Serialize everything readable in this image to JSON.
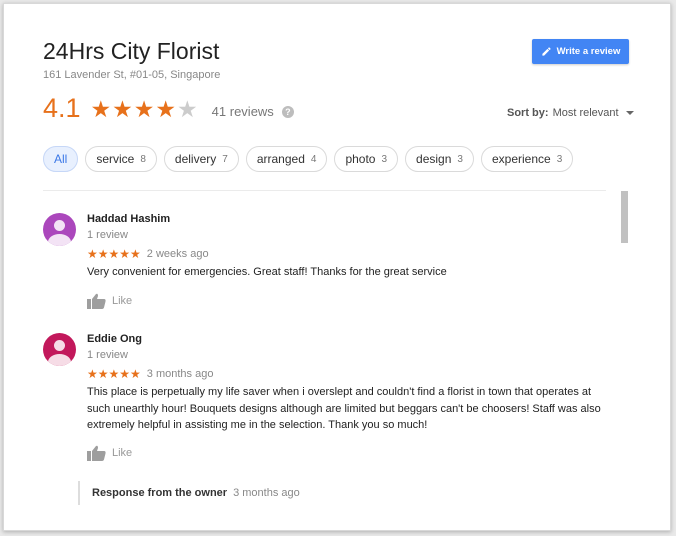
{
  "business": {
    "name": "24Hrs City Florist",
    "address": "161 Lavender St, #01-05, Singapore"
  },
  "write_review_label": "Write a review",
  "rating": {
    "value": "4.1",
    "stars_filled": 4,
    "reviews_label": "41 reviews",
    "help_glyph": "?"
  },
  "sort": {
    "label": "Sort by:",
    "value": "Most relevant"
  },
  "chips": [
    {
      "label": "All",
      "count": ""
    },
    {
      "label": "service",
      "count": "8"
    },
    {
      "label": "delivery",
      "count": "7"
    },
    {
      "label": "arranged",
      "count": "4"
    },
    {
      "label": "photo",
      "count": "3"
    },
    {
      "label": "design",
      "count": "3"
    },
    {
      "label": "experience",
      "count": "3"
    }
  ],
  "reviews": [
    {
      "name": "Haddad Hashim",
      "sub": "1 review",
      "stars": "★★★★★",
      "date": "2 weeks ago",
      "text": "Very convenient for emergencies. Great staff! Thanks for the great service",
      "like_label": "Like",
      "avatar_color": "#ab47bc"
    },
    {
      "name": "Eddie Ong",
      "sub": "1 review",
      "stars": "★★★★★",
      "date": "3 months ago",
      "text": "This place is perpetually my life saver when i overslept and couldn't find a florist in town that operates at such unearthly hour! Bouquets designs although are limited but beggars can't be choosers! Staff was also extremely helpful in assisting me in the selection. Thank you so much!",
      "like_label": "Like",
      "avatar_color": "#c2185b"
    }
  ],
  "owner_response": {
    "label": "Response from the owner",
    "date": "3 months ago"
  },
  "colors": {
    "accent_orange": "#e7711b",
    "button_blue": "#4285f4",
    "chip_active_bg": "#e8f0fe"
  }
}
